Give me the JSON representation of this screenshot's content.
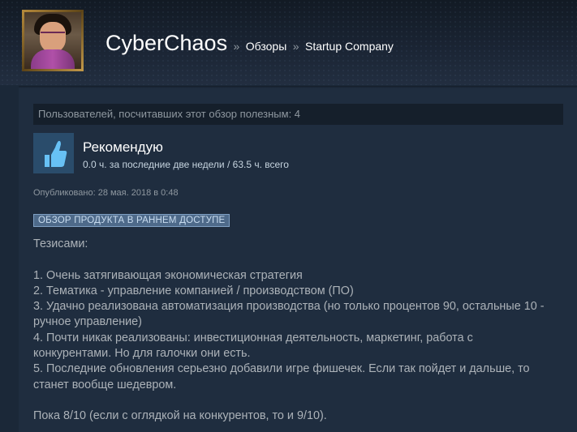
{
  "header": {
    "persona_name": "CyberChaos",
    "separator": "»",
    "breadcrumb_reviews": "Обзоры",
    "breadcrumb_game": "Startup Company"
  },
  "review": {
    "helpful_text": "Пользователей, посчитавших этот обзор полезным: 4",
    "recommendation": "Рекомендую",
    "hours": "0.0 ч. за последние две недели / 63.5 ч. всего",
    "posted": "Опубликовано: 28 мая. 2018 в 0:48",
    "early_access_badge": "ОБЗОР ПРОДУКТА В РАННЕМ ДОСТУПЕ",
    "lines": [
      "Тезисами:",
      "",
      "1. Очень затягивающая экономическая стратегия",
      "2. Тематика - управление компанией / производством (ПО)",
      "3. Удачно реализована автоматизация производства (но только процентов 90, остальные 10 -",
      "ручное управление)",
      "4. Почти никак реализованы: инвестиционная деятельность, маркетинг, работа с",
      "конкурентами. Но для галочки они есть.",
      "5. Последние обновления серьезно добавили игре фишечек. Если так пойдет и дальше, то",
      "станет вообще шедевром.",
      "",
      "Пока 8/10 (если с оглядкой на конкурентов, то и 9/10)."
    ]
  },
  "icons": {
    "recommend": "thumbs-up-icon"
  },
  "colors": {
    "page_bg": "#1b2838",
    "panel_bg": "#1f2d3f",
    "badge_bg": "#4e6a8a",
    "thumb_bg": "#2a4c6b",
    "thumb_fg": "#67c1f5"
  }
}
